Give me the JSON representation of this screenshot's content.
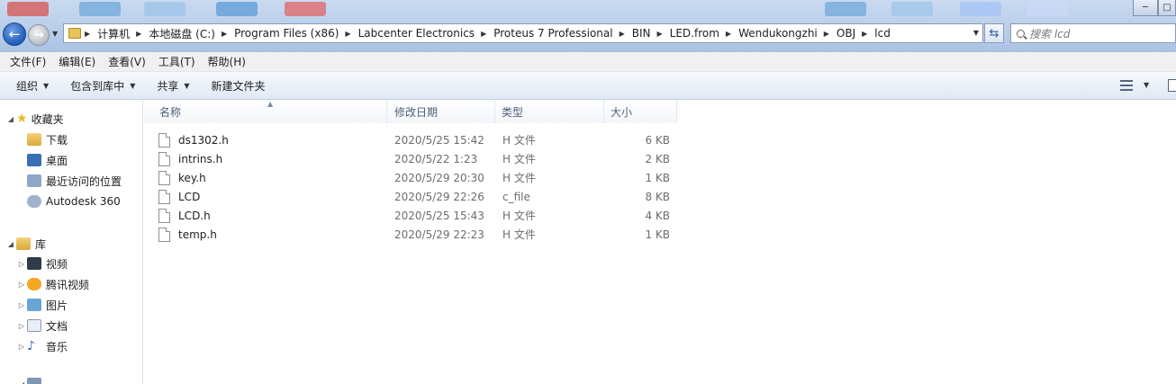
{
  "address": {
    "crumbs": [
      "计算机",
      "本地磁盘 (C:)",
      "Program Files (x86)",
      "Labcenter Electronics",
      "Proteus 7 Professional",
      "BIN",
      "LED.from",
      "Wendukongzhi",
      "OBJ",
      "lcd"
    ]
  },
  "search": {
    "placeholder": "搜索 lcd"
  },
  "menu": [
    "文件(F)",
    "编辑(E)",
    "查看(V)",
    "工具(T)",
    "帮助(H)"
  ],
  "toolbar": {
    "organize": "组织",
    "include_library": "包含到库中",
    "share": "共享",
    "new_folder": "新建文件夹"
  },
  "nav": {
    "favorites": "收藏夹",
    "favorites_items": [
      "下载",
      "桌面",
      "最近访问的位置",
      "Autodesk 360"
    ],
    "libraries": "库",
    "libraries_items": [
      "视频",
      "腾讯视频",
      "图片",
      "文档",
      "音乐"
    ]
  },
  "columns": {
    "name": "名称",
    "date": "修改日期",
    "type": "类型",
    "size": "大小"
  },
  "files": [
    {
      "name": "ds1302.h",
      "date": "2020/5/25 15:42",
      "type": "H 文件",
      "size": "6 KB"
    },
    {
      "name": "intrins.h",
      "date": "2020/5/22 1:23",
      "type": "H 文件",
      "size": "2 KB"
    },
    {
      "name": "key.h",
      "date": "2020/5/29 20:30",
      "type": "H 文件",
      "size": "1 KB"
    },
    {
      "name": "LCD",
      "date": "2020/5/29 22:26",
      "type": "c_file",
      "size": "8 KB"
    },
    {
      "name": "LCD.h",
      "date": "2020/5/25 15:43",
      "type": "H 文件",
      "size": "4 KB"
    },
    {
      "name": "temp.h",
      "date": "2020/5/29 22:23",
      "type": "H 文件",
      "size": "1 KB"
    }
  ]
}
